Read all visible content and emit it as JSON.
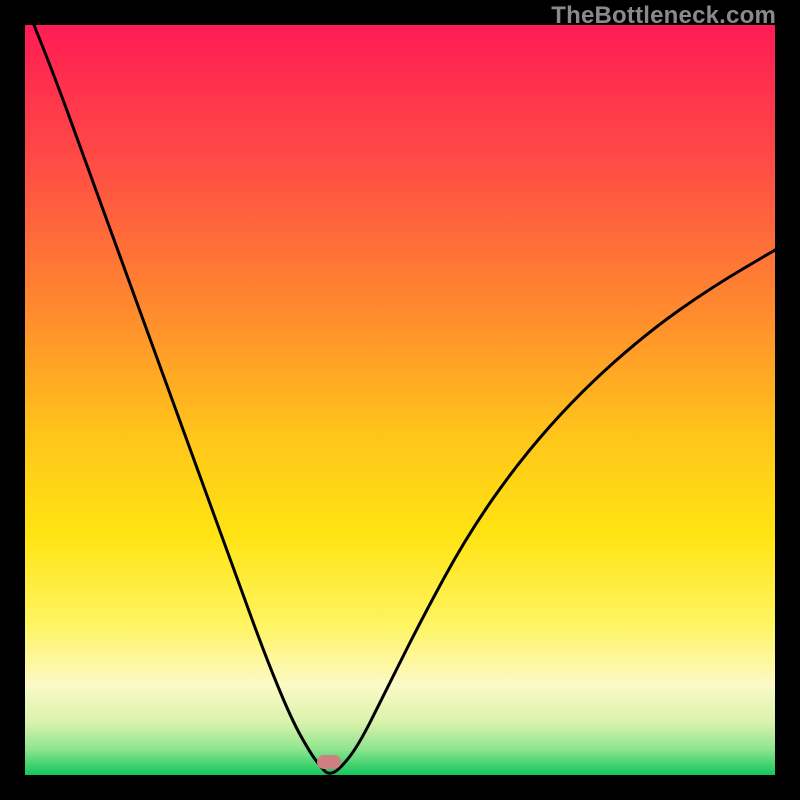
{
  "watermark": "TheBottleneck.com",
  "frame": {
    "outer_margin": 25,
    "bg_color": "#000000"
  },
  "gradient_stops": [
    {
      "pct": 0,
      "color": "#ff1c55"
    },
    {
      "pct": 18,
      "color": "#ff4b45"
    },
    {
      "pct": 38,
      "color": "#ff8a2e"
    },
    {
      "pct": 55,
      "color": "#ffc61a"
    },
    {
      "pct": 68,
      "color": "#ffe412"
    },
    {
      "pct": 80,
      "color": "#fff462"
    },
    {
      "pct": 88,
      "color": "#fcfac6"
    },
    {
      "pct": 93,
      "color": "#d9f2ac"
    },
    {
      "pct": 96.5,
      "color": "#8fe58f"
    },
    {
      "pct": 100,
      "color": "#15c65d"
    }
  ],
  "marker": {
    "x_frac": 0.405,
    "y_frac": 0.983,
    "color": "#cf7f82"
  },
  "chart_data": {
    "type": "line",
    "title": "",
    "xlabel": "",
    "ylabel": "",
    "xlim": [
      0,
      1
    ],
    "ylim": [
      0,
      1
    ],
    "note": "Axes are unitless fractions of the plot area (0=left/top, 1=right/bottom visually). The curve is a V-shaped bottleneck profile touching the bottom near x≈0.405.",
    "series": [
      {
        "name": "bottleneck-curve",
        "x": [
          0.0,
          0.04,
          0.08,
          0.12,
          0.16,
          0.2,
          0.24,
          0.28,
          0.32,
          0.355,
          0.38,
          0.395,
          0.405,
          0.42,
          0.445,
          0.48,
          0.53,
          0.59,
          0.66,
          0.74,
          0.83,
          0.915,
          1.0
        ],
        "y": [
          1.03,
          0.93,
          0.82,
          0.71,
          0.6,
          0.49,
          0.38,
          0.27,
          0.16,
          0.075,
          0.03,
          0.01,
          0.0,
          0.008,
          0.04,
          0.11,
          0.21,
          0.32,
          0.42,
          0.51,
          0.59,
          0.65,
          0.7
        ]
      }
    ]
  }
}
